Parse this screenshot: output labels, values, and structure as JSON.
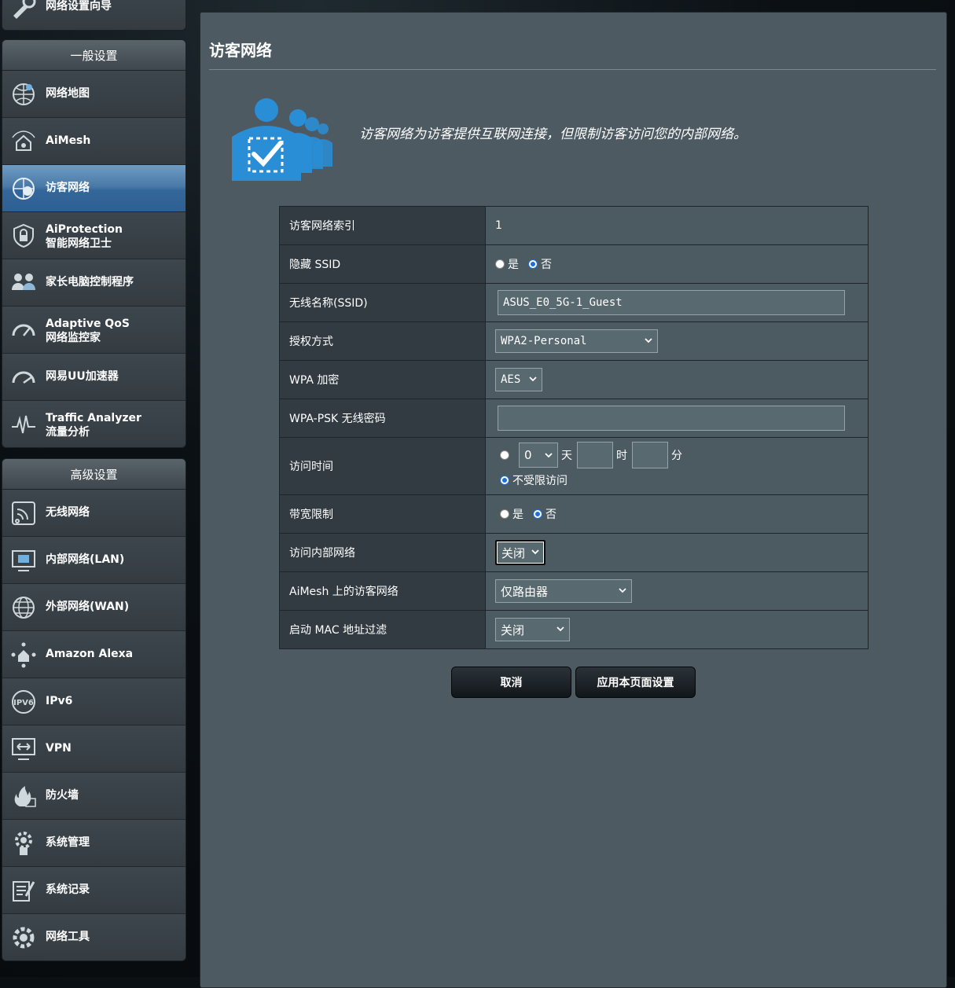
{
  "sidebar": {
    "top_item": {
      "label": "网络设置向导"
    },
    "general": {
      "header": "一般设置",
      "items": [
        {
          "label": "网络地图",
          "sub": "",
          "icon": "network-map-icon"
        },
        {
          "label": "AiMesh",
          "sub": "",
          "icon": "aimesh-icon"
        },
        {
          "label": "访客网络",
          "sub": "",
          "icon": "guest-network-icon",
          "active": true
        },
        {
          "label": "AiProtection",
          "sub": "智能网络卫士",
          "icon": "aiprotection-icon"
        },
        {
          "label": "家长电脑控制程序",
          "sub": "",
          "icon": "parental-control-icon"
        },
        {
          "label": "Adaptive QoS",
          "sub": "网络监控家",
          "icon": "qos-gauge-icon"
        },
        {
          "label": "网易UU加速器",
          "sub": "",
          "icon": "uu-accelerator-icon"
        },
        {
          "label": "Traffic Analyzer",
          "sub": "流量分析",
          "icon": "traffic-analyzer-icon"
        }
      ]
    },
    "advanced": {
      "header": "高级设置",
      "items": [
        {
          "label": "无线网络",
          "icon": "wireless-icon"
        },
        {
          "label": "内部网络(LAN)",
          "icon": "lan-icon"
        },
        {
          "label": "外部网络(WAN)",
          "icon": "wan-globe-icon"
        },
        {
          "label": "Amazon Alexa",
          "icon": "alexa-icon"
        },
        {
          "label": "IPv6",
          "icon": "ipv6-icon"
        },
        {
          "label": "VPN",
          "icon": "vpn-icon"
        },
        {
          "label": "防火墙",
          "icon": "firewall-icon"
        },
        {
          "label": "系统管理",
          "icon": "system-admin-icon"
        },
        {
          "label": "系统记录",
          "icon": "system-log-icon"
        },
        {
          "label": "网络工具",
          "icon": "network-tools-icon"
        }
      ]
    }
  },
  "main": {
    "title": "访客网络",
    "description": "访客网络为访客提供互联网连接，但限制访客访问您的内部网络。",
    "rows": {
      "index": {
        "label": "访客网络索引",
        "value": "1"
      },
      "hide_ssid": {
        "label": "隐藏 SSID",
        "yes": "是",
        "no": "否",
        "selected": "否"
      },
      "ssid": {
        "label": "无线名称(SSID)",
        "value": "ASUS_E0_5G-1_Guest"
      },
      "auth": {
        "label": "授权方式",
        "value": "WPA2-Personal"
      },
      "wpa_enc": {
        "label": "WPA 加密",
        "value": "AES"
      },
      "psk": {
        "label": "WPA-PSK 无线密码",
        "value": ""
      },
      "access_time": {
        "label": "访问时间",
        "days": "0",
        "day_unit": "天",
        "hour_value": "",
        "hour_unit": "时",
        "minute_value": "",
        "minute_unit": "分",
        "unlimited": "不受限访问",
        "selected": "不受限访问"
      },
      "bandwidth": {
        "label": "带宽限制",
        "yes": "是",
        "no": "否",
        "selected": "否"
      },
      "intranet": {
        "label": "访问内部网络",
        "value": "关闭"
      },
      "aimesh": {
        "label": "AiMesh 上的访客网络",
        "value": "仅路由器"
      },
      "mac_filter": {
        "label": "启动 MAC 地址过滤",
        "value": "关闭"
      }
    },
    "buttons": {
      "cancel": "取消",
      "apply": "应用本页面设置"
    }
  },
  "colors": {
    "panel": "#4d5a62",
    "row_header": "#313b41",
    "active_menu": "#2f5f92",
    "radio_accent": "#1f6fd6",
    "hero_icon": "#2a8ed6"
  }
}
